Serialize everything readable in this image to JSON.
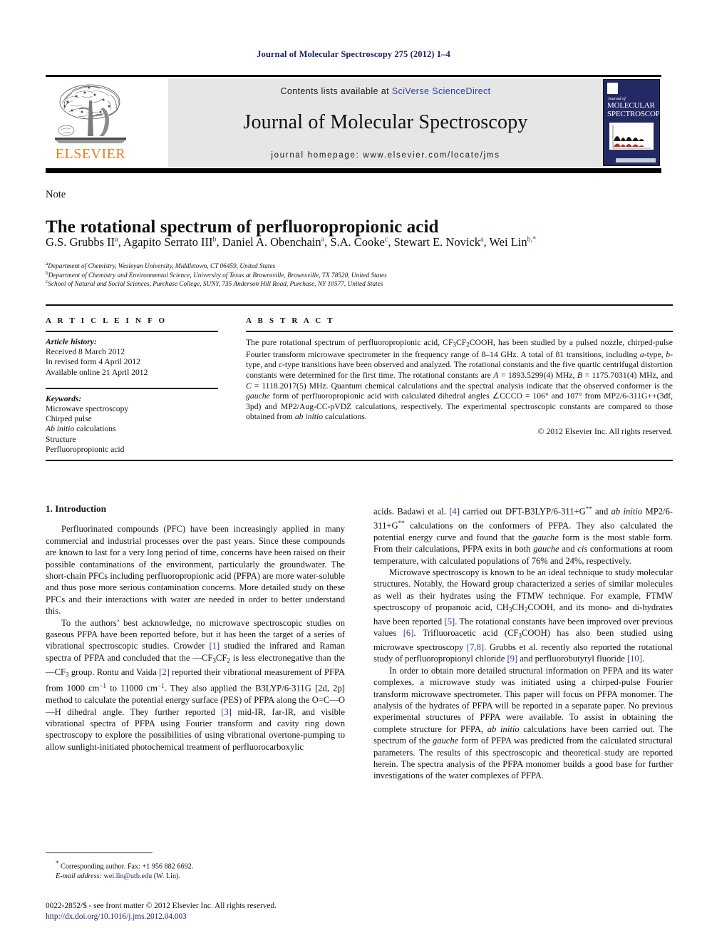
{
  "running_head": "Journal of Molecular Spectroscopy 275 (2012) 1–4",
  "masthead": {
    "contents_prefix": "Contents lists available at ",
    "sciencedirect": "SciVerse ScienceDirect",
    "journal_title": "Journal of Molecular Spectroscopy",
    "homepage": "journal homepage: www.elsevier.com/locate/jms",
    "publisher_word": "ELSEVIER",
    "accent_orange": "#ef7d22",
    "link_blue": "#2f3a9e",
    "band_gray": "#e6e6e6"
  },
  "cover": {
    "journal_of": "Journal of",
    "title_line1": "MOLECULAR",
    "title_line2": "SPECTROSCOPY",
    "background": "#232a63"
  },
  "article": {
    "type_label": "Note",
    "title": "The rotational spectrum of perfluoropropionic acid",
    "authors_html": "G.S. Grubbs II<sup>a</sup>, Agapito Serrato III<sup>b</sup>, Daniel A. Obenchain<sup>a</sup>, S.A. Cooke<sup>c</sup>, Stewart E. Novick<sup>a</sup>, Wei Lin<sup>b,*</sup>",
    "affiliations": [
      "Department of Chemistry, Wesleyan University, Middletown, CT 06459, United States",
      "Department of Chemistry and Environmental Science, University of Texas at Brownsville, Brownsville, TX 78520, United States",
      "School of Natural and Social Sciences, Purchase College, SUNY, 735 Anderson Hill Road, Purchase, NY 10577, United States"
    ],
    "affiliation_markers": [
      "a",
      "b",
      "c"
    ]
  },
  "article_info": {
    "heading": "A R T I C L E  I N F O",
    "history_label": "Article history:",
    "history": [
      "Received 8 March 2012",
      "In revised form 4 April 2012",
      "Available online 21 April 2012"
    ],
    "keywords_label": "Keywords:",
    "keywords": [
      "Microwave spectroscopy",
      "Chirped pulse",
      "Ab initio calculations",
      "Structure",
      "Perfluoropropionic acid"
    ]
  },
  "abstract": {
    "heading": "A B S T R A C T",
    "body_html": "The pure rotational spectrum of perfluoropropionic acid, CF<span class=\"sub\">3</span>CF<span class=\"sub\">2</span>COOH, has been studied by a pulsed nozzle, chirped-pulse Fourier transform microwave spectrometer in the frequency range of 8&ndash;14 GHz. A total of 81 transitions, including <i>a</i>-type, <i>b</i>-type, and <i>c</i>-type transitions have been observed and analyzed. The rotational constants and the five quartic centrifugal distortion constants were determined for the first time. The rotational constants are <i>A</i> = 1893.5299(4) MHz, <i>B</i> = 1175.7031(4) MHz, and <i>C</i> = 1118.2017(5) MHz. Quantum chemical calculations and the spectral analysis indicate that the observed conformer is the <i>gauche</i> form of perfluoropropionic acid with calculated dihedral angles &ang;CCCO = 106&deg; and 107&deg; from MP2/6-311G++(3df, 3pd) and MP2/Aug-CC-pVDZ calculations, respectively. The experimental spectroscopic constants are compared to those obtained from <i>ab initio</i> calculations.",
    "copyright": "© 2012 Elsevier Inc. All rights reserved."
  },
  "introduction": {
    "section_title": "1. Introduction",
    "left_paragraphs_html": [
      "Perfluorinated compounds (PFC) have been increasingly applied in many commercial and industrial processes over the past years. Since these compounds are known to last for a very long period of time, concerns have been raised on their possible contaminations of the environment, particularly the groundwater. The short-chain PFCs including perfluoropropionic acid (PFPA) are more water-soluble and thus pose more serious contamination concerns. More detailed study on these PFCs and their interactions with water are needed in order to better understand this.",
      "To the authors&rsquo; best acknowledge, no microwave spectroscopic studies on gaseous PFPA have been reported before, but it has been the target of a series of vibrational spectroscopic studies. Crowder <span class=\"ref\">[1]</span> studied the infrared and Raman spectra of PFPA and concluded that the &mdash;CF<span class=\"sub\">3</span>CF<span class=\"sub\">2</span> is less electronegative than the &mdash;CF<span class=\"sub\">3</span> group. Rontu and Vaida <span class=\"ref\">[2]</span> reported their vibrational measurement of PFPA from 1000 cm<span class=\"sup\">&minus;1</span> to 11000 cm<span class=\"sup\">&minus;1</span>. They also applied the B3LYP/6-311G [2d, 2p] method to calculate the potential energy surface (PES) of PFPA along the O=C&mdash;O&mdash;H dihedral angle. They further reported <span class=\"ref\">[3]</span> mid-IR, far-IR, and visible vibrational spectra of PFPA using Fourier transform and cavity ring down spectroscopy to explore the possibilities of using vibrational overtone-pumping to allow sunlight-initiated photochemical treatment of perfluorocarboxylic"
    ],
    "right_paragraphs_html": [
      "acids. Badawi et al. <span class=\"ref\">[4]</span> carried out DFT-B3LYP/6-311+G<span class=\"sup\">**</span> and <i>ab initio</i> MP2/6-311+G<span class=\"sup\">**</span> calculations on the conformers of PFPA. They also calculated the potential energy curve and found that the <i>gauche</i> form is the most stable form. From their calculations, PFPA exits in both <i>gauche</i> and <i>cis</i> conformations at room temperature, with calculated populations of 76% and 24%, respectively.",
      "Microwave spectroscopy is known to be an ideal technique to study molecular structures. Notably, the Howard group characterized a series of similar molecules as well as their hydrates using the FTMW technique. For example, FTMW spectroscopy of propanoic acid, CH<span class=\"sub\">3</span>CH<span class=\"sub\">2</span>COOH, and its mono- and di-hydrates have been reported <span class=\"ref\">[5]</span>. The rotational constants have been improved over previous values <span class=\"ref\">[6]</span>. Trifluoroacetic acid (CF<span class=\"sub\">3</span>COOH) has also been studied using microwave spectroscopy <span class=\"ref\">[7,8]</span>. Grubbs et al. recently also reported the rotational study of perfluoropropionyl chloride <span class=\"ref\">[9]</span> and perfluorobutyryl fluoride <span class=\"ref\">[10]</span>.",
      "In order to obtain more detailed structural information on PFPA and its water complexes, a microwave study was initiated using a chirped-pulse Fourier transform microwave spectrometer. This paper will focus on PFPA monomer. The analysis of the hydrates of PFPA will be reported in a separate paper. No previous experimental structures of PFPA were available. To assist in obtaining the complete structure for PFPA, <i>ab initio</i> calculations have been carried out. The spectrum of the <i>gauche</i> form of PFPA was predicted from the calculated structural parameters. The results of this spectroscopic and theoretical study are reported herein. The spectra analysis of the PFPA monomer builds a good base for further investigations of the water complexes of PFPA."
    ]
  },
  "footnotes": {
    "corresponding_html": "<span class=\"sup\">*</span> Corresponding author. Fax: +1 956 882 6692.",
    "email_label": "E-mail address:",
    "email": "wei.lin@utb.edu",
    "email_owner": "(W. Lin)."
  },
  "imprint": {
    "issn_line": "0022-2852/$ - see front matter © 2012 Elsevier Inc. All rights reserved.",
    "doi": "http://dx.doi.org/10.1016/j.jms.2012.04.003"
  }
}
